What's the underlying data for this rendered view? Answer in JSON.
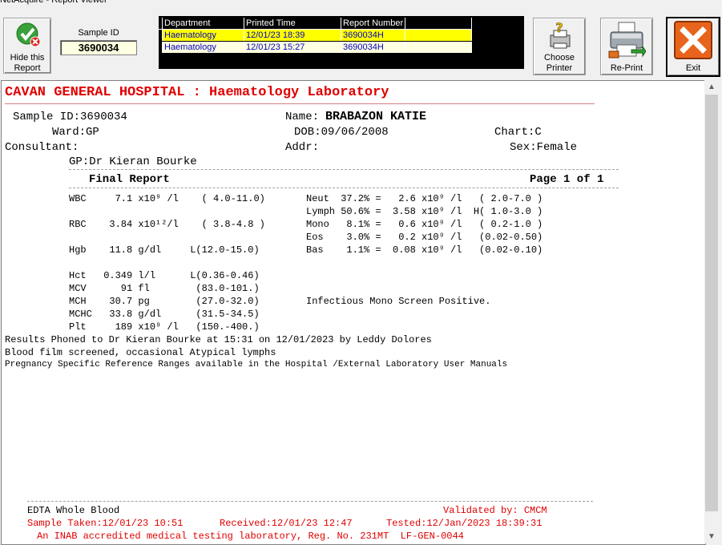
{
  "window": {
    "title": "NetAcquire - Report Viewer"
  },
  "toolbar": {
    "hide_label_1": "Hide this",
    "hide_label_2": "Report",
    "sample_id_label": "Sample ID",
    "sample_id_value": "3690034",
    "choose_printer_1": "Choose",
    "choose_printer_2": "Printer",
    "reprint_label": "Re-Print",
    "exit_label": "Exit"
  },
  "reports_grid": {
    "headers": [
      "Department",
      "Printed Time",
      "Report Number",
      ""
    ],
    "rows": [
      [
        "Haematology",
        "12/01/23 18:39",
        "3690034H",
        ""
      ],
      [
        "Haematology",
        "12/01/23 15:27",
        "3690034H",
        ""
      ]
    ]
  },
  "report": {
    "hospital_title": "CAVAN GENERAL HOSPITAL : Haematology Laboratory",
    "sample_id": "Sample ID:3690034",
    "name_label": "Name:",
    "name_value": "BRABAZON KATIE",
    "ward": "Ward:GP",
    "dob": "DOB:09/06/2008",
    "chart": "Chart:C",
    "consultant": "Consultant:",
    "addr": "Addr:",
    "sex": "Sex:Female",
    "gp": "GP:Dr Kieran Bourke",
    "final_report": "Final Report",
    "page": "Page 1 of 1",
    "results_left": [
      "WBC     7.1 x10⁹ /l    ( 4.0-11.0)",
      "",
      "RBC    3.84 x10¹²/l    ( 3.8-4.8 )",
      "",
      "Hgb    11.8 g/dl     L(12.0-15.0)",
      "",
      "Hct   0.349 l/l      L(0.36-0.46)",
      "MCV      91 fl        (83.0-101.)",
      "MCH    30.7 pg        (27.0-32.0)",
      "MCHC   33.8 g/dl      (31.5-34.5)",
      "Plt     189 x10⁹ /l   (150.-400.)"
    ],
    "results_right": [
      "Neut  37.2% =   2.6 x10⁹ /l   ( 2.0-7.0 )",
      "Lymph 50.6% =  3.58 x10⁹ /l  H( 1.0-3.0 )",
      "Mono   8.1% =   0.6 x10⁹ /l   ( 0.2-1.0 )",
      "Eos    3.0% =   0.2 x10⁹ /l   (0.02-0.50)",
      "Bas    1.1% =  0.08 x10⁹ /l   (0.02-0.10)"
    ],
    "comment_mono": "Infectious Mono Screen Positive.",
    "phoned": "Results Phoned to Dr Kieran Bourke at 15:31 on 12/01/2023 by Leddy Dolores",
    "blood_film": "Blood film screened, occasional Atypical lymphs",
    "pregnancy": "Pregnancy Specific Reference Ranges available in the Hospital /External Laboratory User Manuals",
    "specimen": "EDTA Whole Blood",
    "validated": "Validated by: CMCM",
    "sample_taken": "Sample Taken:12/01/23 10:51",
    "received": "Received:12/01/23 12:47",
    "tested": "Tested:12/Jan/2023 18:39:31",
    "inab": "An INAB accredited medical testing laboratory, Reg. No. 231MT  LF-GEN-0044"
  },
  "colors": {
    "title_red": "#e00000",
    "grid_selected": "#ffff00",
    "grid_row": "#ffffe1",
    "grid_text": "#0000c0"
  }
}
